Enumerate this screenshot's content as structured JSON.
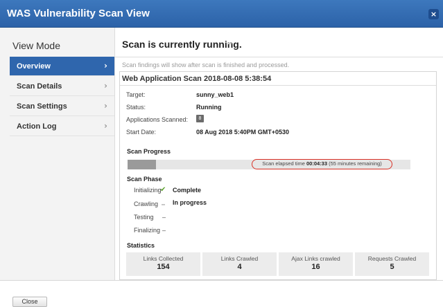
{
  "window": {
    "title": "WAS Vulnerability Scan View",
    "close_glyph": "×"
  },
  "sidebar": {
    "heading": "View Mode",
    "items": [
      {
        "label": "Overview",
        "active": true
      },
      {
        "label": "Scan Details",
        "active": false
      },
      {
        "label": "Scan Settings",
        "active": false
      },
      {
        "label": "Action Log",
        "active": false
      }
    ],
    "chevron": "›"
  },
  "main": {
    "status_title": "Scan is currently running.",
    "notice": "Scan findings will show after scan is finished and processed.",
    "scan_title": "Web Application Scan 2018-08-08 5:38:54",
    "details": [
      {
        "label": "Target:",
        "value": "sunny_web1"
      },
      {
        "label": "Status:",
        "value": "Running"
      },
      {
        "label": "Applications Scanned:",
        "value": ""
      },
      {
        "label": "Start Date:",
        "value": "08 Aug 2018 5:40PM GMT+0530"
      }
    ],
    "applications_badge": "8",
    "progress": {
      "title": "Scan Progress",
      "fraction": 0.1,
      "elapsed_prefix": "Scan elapsed time",
      "elapsed_time": "00:04:33",
      "elapsed_suffix": "(55 minutes remaining)"
    },
    "phases": {
      "title": "Scan Phase",
      "items": [
        {
          "name": "Initializing",
          "icon": "check-icon",
          "glyph": "✔",
          "status": "Complete"
        },
        {
          "name": "Crawling",
          "icon": "spinner-icon",
          "status": "In progress"
        },
        {
          "name": "Testing",
          "status": "–"
        },
        {
          "name": "Finalizing",
          "status": "–"
        }
      ]
    },
    "statistics": {
      "title": "Statistics",
      "cards": [
        {
          "label": "Links Collected",
          "value": "154"
        },
        {
          "label": "Links Crawled",
          "value": "4"
        },
        {
          "label": "Ajax Links crawled",
          "value": "16"
        },
        {
          "label": "Requests Crawled",
          "value": "5"
        }
      ]
    }
  },
  "footer": {
    "close_label": "Close"
  },
  "colors": {
    "titlebar": "#2f66ad",
    "active_nav": "#2f66ad",
    "highlight_oval": "#d93025",
    "check": "#5aa02c"
  }
}
